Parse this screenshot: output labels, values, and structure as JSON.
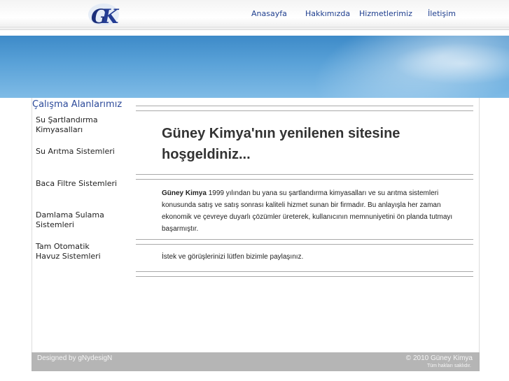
{
  "header": {
    "logo_alt": "GK",
    "nav": [
      "Anasayfa",
      "Hakkımızda",
      "Hizmetlerimiz",
      "İletişim"
    ]
  },
  "sidebar": {
    "title": "Çalışma Alanlarımız",
    "items": [
      {
        "line1": "Su Şartlandırma",
        "line2": "Kimyasalları"
      },
      {
        "line1": "Su Arıtma Sistemleri",
        "line2": ""
      },
      {
        "line1": "Baca Filtre Sistemleri",
        "line2": ""
      },
      {
        "line1": "Damlama Sulama",
        "line2": "Sistemleri"
      },
      {
        "line1": "Tam Otomatik",
        "line2": "Havuz Sistemleri"
      }
    ]
  },
  "main": {
    "headline": "Güney Kimya'nın yenilenen sitesine hoşgeldiniz...",
    "intro_bold": "Güney Kimya",
    "intro_text": " 1999 yılından bu yana su şartlandırma kimyasalları ve su arıtma sistemleri konusunda satış ve satış sonrası kaliteli hizmet sunan bir firmadır. Bu anlayışla her zaman ekonomik ve çevreye duyarlı çözümler üreterek, kullanıcının memnuniyetini ön planda tutmayı başarmıştır.",
    "request": "İstek ve görüşlerinizi lütfen bizimle paylaşınız."
  },
  "footer": {
    "designer": "Designed by gNydesigN",
    "copyright": "© 2010 Güney Kimya",
    "rights": "Tüm hakları saklıdır."
  },
  "colors": {
    "nav_link": "#1f3f8f",
    "banner_top": "#3d8ac8",
    "banner_bottom": "#7fbbe6",
    "footer_bg": "#b5b5b5"
  }
}
